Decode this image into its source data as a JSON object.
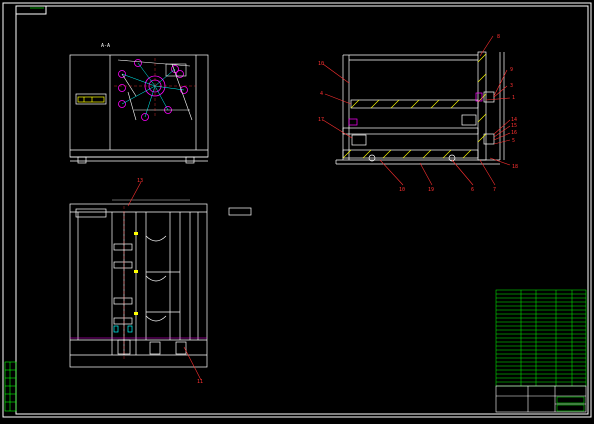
{
  "colors": {
    "background": "#000000",
    "frame": "#ffffff",
    "outline": "#ffffff",
    "leader": "#ff3030",
    "label": "#ff3030",
    "magenta": "#ff00ff",
    "yellow": "#ffff00",
    "cyan": "#00ffff",
    "green": "#00ff00",
    "table": "#00ff00"
  },
  "section_label": "A-A",
  "callouts": {
    "c8": "8",
    "c10": "10",
    "c9": "9",
    "c4": "4",
    "c3": "3",
    "c1": "1",
    "c17": "17",
    "c14": "14",
    "c15": "15",
    "c16": "16",
    "c5": "5",
    "c18": "18",
    "c19": "19",
    "c6": "6",
    "c7": "7",
    "c13": "13",
    "c11": "11"
  }
}
